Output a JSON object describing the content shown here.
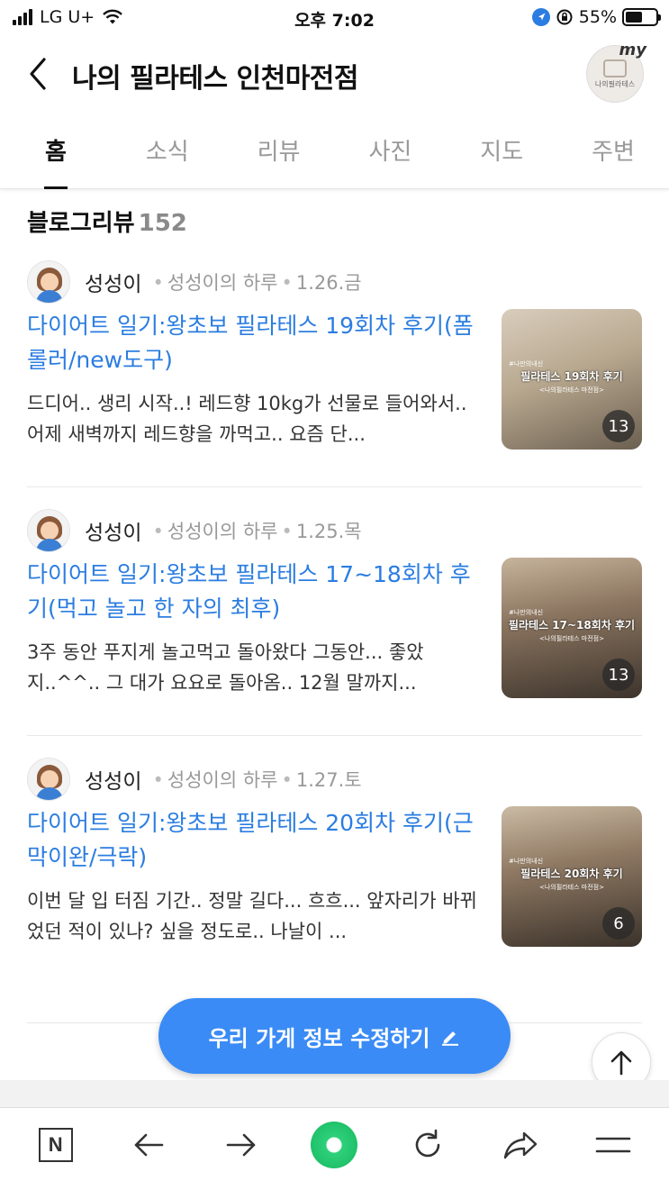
{
  "status_bar": {
    "carrier": "LG U+",
    "time": "오후 7:02",
    "battery": "55%",
    "battery_level": 0.55
  },
  "header": {
    "title": "나의 필라테스 인천마전점",
    "logo_badge": "my",
    "logo_text": "나의필라테스"
  },
  "tabs": [
    {
      "label": "홈",
      "active": true
    },
    {
      "label": "소식",
      "active": false
    },
    {
      "label": "리뷰",
      "active": false
    },
    {
      "label": "사진",
      "active": false
    },
    {
      "label": "지도",
      "active": false
    },
    {
      "label": "주변",
      "active": false
    }
  ],
  "blog_reviews": {
    "heading": "블로그리뷰",
    "count": "152",
    "items": [
      {
        "author": "성성이",
        "blog": "성성이의 하루",
        "date": "1.26.금",
        "title": "다이어트 일기:왕초보 필라테스 19회차 후기(폼롤러/new도구)",
        "snippet": "드디어.. 생리 시작..! 레드향 10kg가 선물로 들어와서.. 어제 새벽까지 레드향을 까먹고.. 요즘 단...",
        "thumb_tag": "#나만의내신",
        "thumb_caption": "필라테스 19회차 후기",
        "thumb_sub": "<나의필라테스 마전점>",
        "photo_count": "13"
      },
      {
        "author": "성성이",
        "blog": "성성이의 하루",
        "date": "1.25.목",
        "title": "다이어트 일기:왕초보 필라테스 17~18회차 후기(먹고 놀고 한 자의 최후)",
        "snippet": "3주 동안 푸지게 놀고먹고 돌아왔다 그동안... 좋았지..^^.. 그 대가 요요로 돌아옴.. 12월 말까지...",
        "thumb_tag": "#나만의내신",
        "thumb_caption": "필라테스 17~18회차 후기",
        "thumb_sub": "<나의필라테스 마전점>",
        "photo_count": "13"
      },
      {
        "author": "성성이",
        "blog": "성성이의 하루",
        "date": "1.27.토",
        "title": "다이어트 일기:왕초보 필라테스 20회차 후기(근막이완/극락)",
        "snippet": "이번 달 입 터짐 기간.. 정말 길다... 흐흐... 앞자리가 바뀌었던 적이 있나? 싶을 정도로.. 나날이 ...",
        "thumb_tag": "#나만의내신",
        "thumb_caption": "필라테스 20회차 후기",
        "thumb_sub": "<나의필라테스 마전점>",
        "photo_count": "6"
      }
    ]
  },
  "actions": {
    "edit_info_label": "우리 가게 정보 수정하기"
  },
  "toolbar": {
    "naver_label": "N"
  },
  "colors": {
    "link_blue": "#2b7de1",
    "button_blue": "#3a8bf5",
    "green": "#1fc16a"
  }
}
